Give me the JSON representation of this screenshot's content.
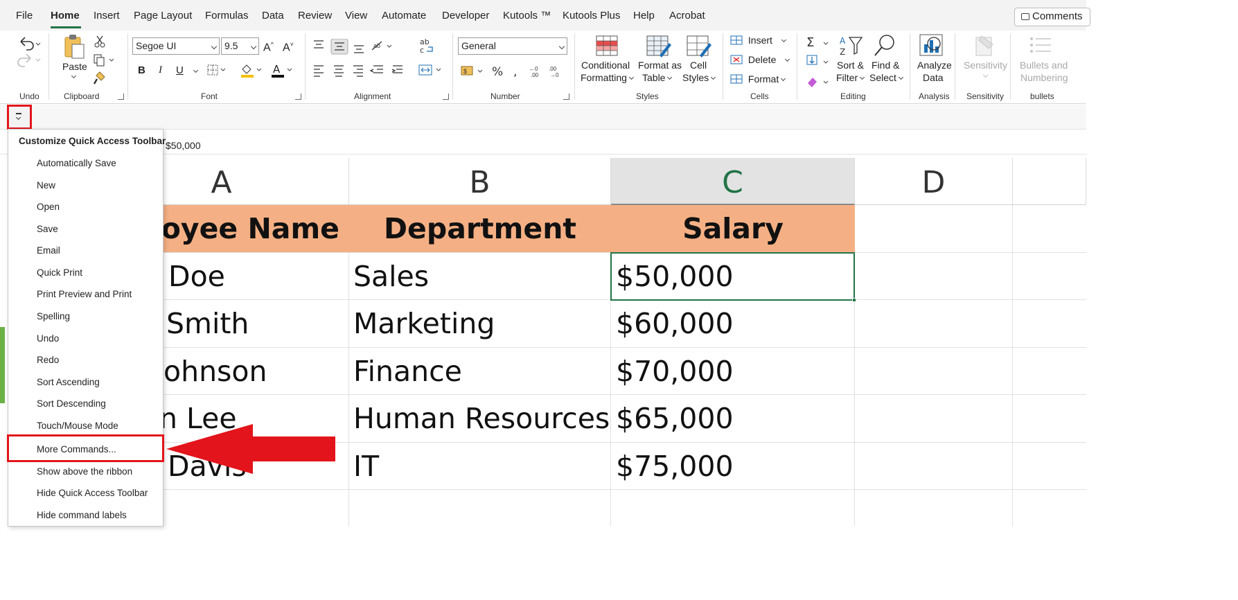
{
  "menubar": {
    "tabs": [
      "File",
      "Home",
      "Insert",
      "Page Layout",
      "Formulas",
      "Data",
      "Review",
      "View",
      "Automate",
      "Developer",
      "Kutools ™",
      "Kutools Plus",
      "Help",
      "Acrobat"
    ],
    "active_tab": "Home",
    "comments_label": "Comments"
  },
  "ribbon": {
    "undo_group": "Undo",
    "clipboard": {
      "group": "Clipboard",
      "paste": "Paste"
    },
    "font": {
      "group": "Font",
      "family": "Segoe UI",
      "size": "9.5",
      "bold": "B",
      "italic": "I",
      "underline": "U"
    },
    "alignment": {
      "group": "Alignment"
    },
    "number": {
      "group": "Number",
      "format": "General"
    },
    "styles": {
      "group": "Styles",
      "conditional_l1": "Conditional",
      "conditional_l2": "Formatting",
      "format_table_l1": "Format as",
      "format_table_l2": "Table",
      "cell_styles_l1": "Cell",
      "cell_styles_l2": "Styles"
    },
    "cells": {
      "group": "Cells",
      "insert": "Insert",
      "delete": "Delete",
      "format": "Format"
    },
    "editing": {
      "group": "Editing",
      "sort_l1": "Sort &",
      "sort_l2": "Filter",
      "find_l1": "Find &",
      "find_l2": "Select"
    },
    "analysis": {
      "group": "Analysis",
      "l1": "Analyze",
      "l2": "Data"
    },
    "sensitivity": {
      "group": "Sensitivity",
      "label": "Sensitivity"
    },
    "bullets": {
      "group": "bullets",
      "l1": "Bullets and",
      "l2": "Numbering"
    }
  },
  "formula_bar": {
    "value": "$50,000"
  },
  "grid": {
    "columns": [
      "A",
      "B",
      "C",
      "D"
    ],
    "selected_column": "C",
    "header_row": [
      "ployee Name",
      "Department",
      "Salary"
    ],
    "rows": [
      [
        "Doe",
        "Sales",
        "$50,000"
      ],
      [
        "Smith",
        "Marketing",
        "$60,000"
      ],
      [
        "ohnson",
        "Finance",
        "$70,000"
      ],
      [
        "n Lee",
        "Human Resources",
        "$65,000"
      ],
      [
        "Davis",
        "IT",
        "$75,000"
      ]
    ]
  },
  "dropdown": {
    "title": "Customize Quick Access Toolbar",
    "items": [
      "Automatically Save",
      "New",
      "Open",
      "Save",
      "Email",
      "Quick Print",
      "Print Preview and Print",
      "Spelling",
      "Undo",
      "Redo",
      "Sort Ascending",
      "Sort Descending",
      "Touch/Mouse Mode",
      "More Commands...",
      "Show above the ribbon",
      "Hide Quick Access Toolbar",
      "Hide command labels"
    ],
    "highlighted_item": "More Commands..."
  },
  "colors": {
    "accent": "#217346",
    "header_fill": "#f4b084",
    "highlight_red": "#e3141b"
  }
}
